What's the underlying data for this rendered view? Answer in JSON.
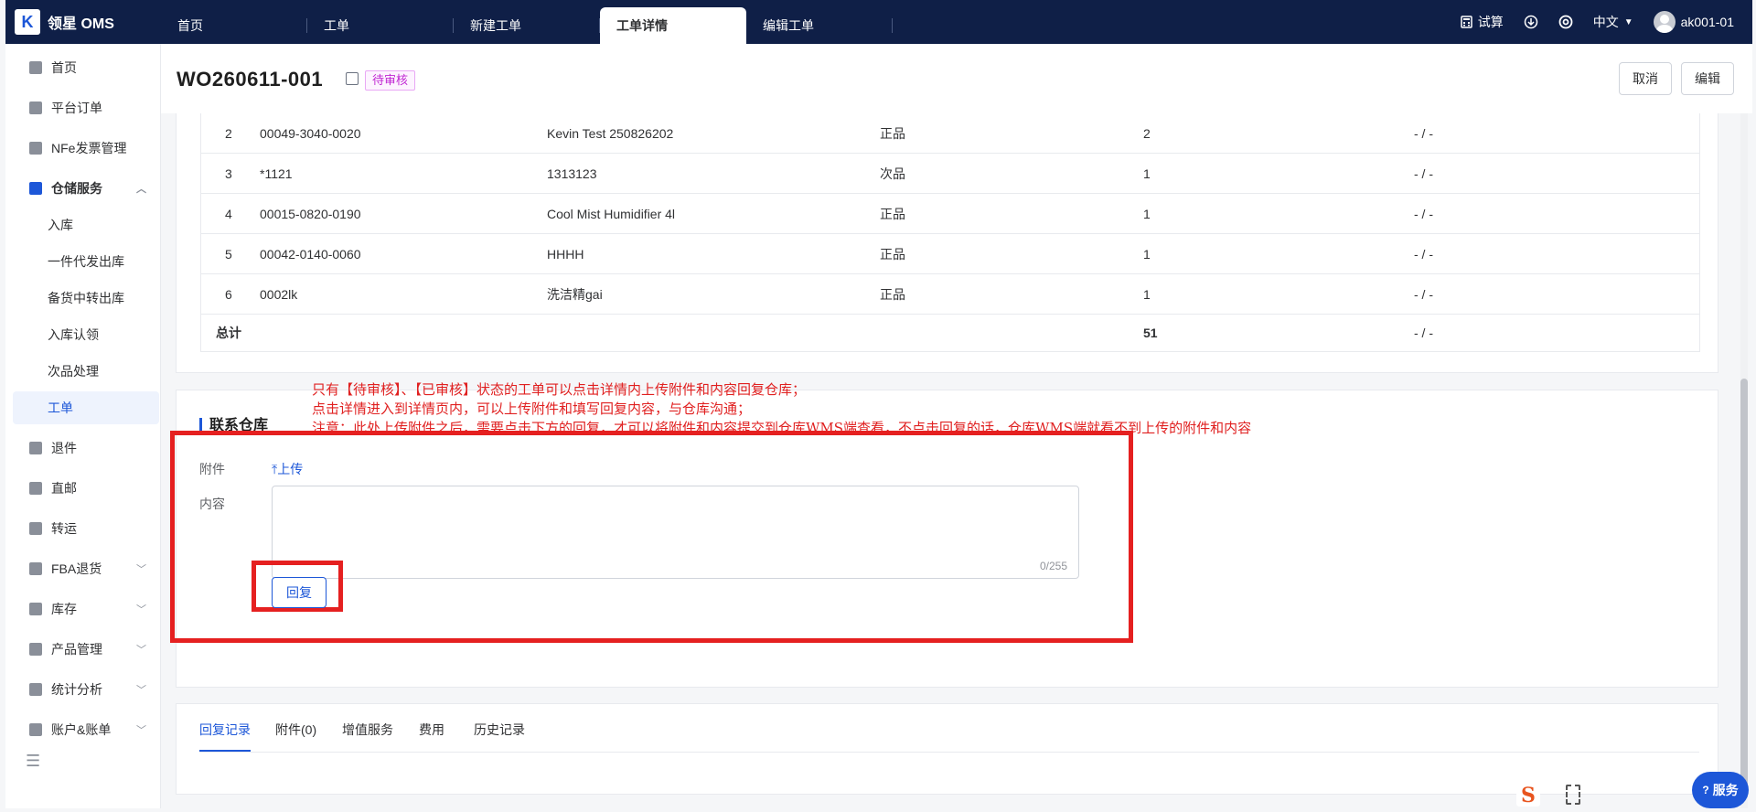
{
  "app": {
    "name": "领星 OMS",
    "logo_letter": "K"
  },
  "top_tabs": [
    {
      "label": "首页"
    },
    {
      "label": "工单"
    },
    {
      "label": "新建工单"
    },
    {
      "label": "工单详情"
    },
    {
      "label": "编辑工单"
    }
  ],
  "active_tab_index": 3,
  "header_right": {
    "calc_label": "试算",
    "lang_label": "中文",
    "user_name": "ak001-01"
  },
  "sidebar": {
    "items": [
      {
        "label": "首页",
        "icon": "home-icon"
      },
      {
        "label": "平台订单",
        "icon": "order-icon"
      },
      {
        "label": "NFe发票管理",
        "icon": "invoice-icon"
      },
      {
        "label": "仓储服务",
        "icon": "warehouse-icon",
        "expanded": true
      },
      {
        "label": "退件",
        "icon": "return-icon"
      },
      {
        "label": "直邮",
        "icon": "direct-mail-icon"
      },
      {
        "label": "转运",
        "icon": "transfer-icon"
      },
      {
        "label": "FBA退货",
        "icon": "fba-icon"
      },
      {
        "label": "库存",
        "icon": "inventory-icon"
      },
      {
        "label": "产品管理",
        "icon": "product-icon"
      },
      {
        "label": "统计分析",
        "icon": "stats-icon"
      },
      {
        "label": "账户&账单",
        "icon": "account-icon"
      }
    ],
    "sub_items": [
      {
        "label": "入库"
      },
      {
        "label": "一件代发出库"
      },
      {
        "label": "备货中转出库"
      },
      {
        "label": "入库认领"
      },
      {
        "label": "次品处理"
      },
      {
        "label": "工单"
      }
    ],
    "active_sub_index": 5
  },
  "page": {
    "wo_number": "WO260611-001",
    "status": "待审核",
    "cancel_label": "取消",
    "edit_label": "编辑"
  },
  "table": {
    "rows": [
      {
        "idx": "2",
        "sku": "00049-3040-0020",
        "name": "Kevin Test 250826202",
        "quality": "正品",
        "qty": "2",
        "extra": "- / -"
      },
      {
        "idx": "3",
        "sku": "*1121",
        "name": "1313123",
        "quality": "次品",
        "qty": "1",
        "extra": "- / -"
      },
      {
        "idx": "4",
        "sku": "00015-0820-0190",
        "name": "Cool Mist Humidifier 4l",
        "quality": "正品",
        "qty": "1",
        "extra": "- / -"
      },
      {
        "idx": "5",
        "sku": "00042-0140-0060",
        "name": "HHHH",
        "quality": "正品",
        "qty": "1",
        "extra": "- / -"
      },
      {
        "idx": "6",
        "sku": "0002lk",
        "name": "洗洁精gai",
        "quality": "正品",
        "qty": "1",
        "extra": "- / -"
      }
    ],
    "total": {
      "label": "总计",
      "qty": "51",
      "extra": "- / -"
    }
  },
  "contact": {
    "title": "联系仓库",
    "note_lines": [
      "只有【待审核】、【已审核】状态的工单可以点击详情内上传附件和内容回复仓库；",
      "点击详情进入到详情页内，可以上传附件和填写回复内容，与仓库沟通；",
      "注意：此处上传附件之后，需要点击下方的回复，才可以将附件和内容提交到仓库WMS端查看，不点击回复的话，仓库WMS端就看不到上传的附件和内容"
    ],
    "attachment_label": "附件",
    "upload_label": "上传",
    "content_label": "内容",
    "content_value": "",
    "counter": "0/255",
    "reply_label": "回复"
  },
  "bottom_tabs": [
    {
      "label": "回复记录"
    },
    {
      "label": "附件(0)"
    },
    {
      "label": "增值服务"
    },
    {
      "label": "费用"
    },
    {
      "label": "历史记录"
    }
  ],
  "service_label": "服务",
  "colors": {
    "topbar": "#0f1f47",
    "accent": "#1d57d8",
    "annotation_red": "#e52020",
    "status_purple": "#c026d3"
  }
}
